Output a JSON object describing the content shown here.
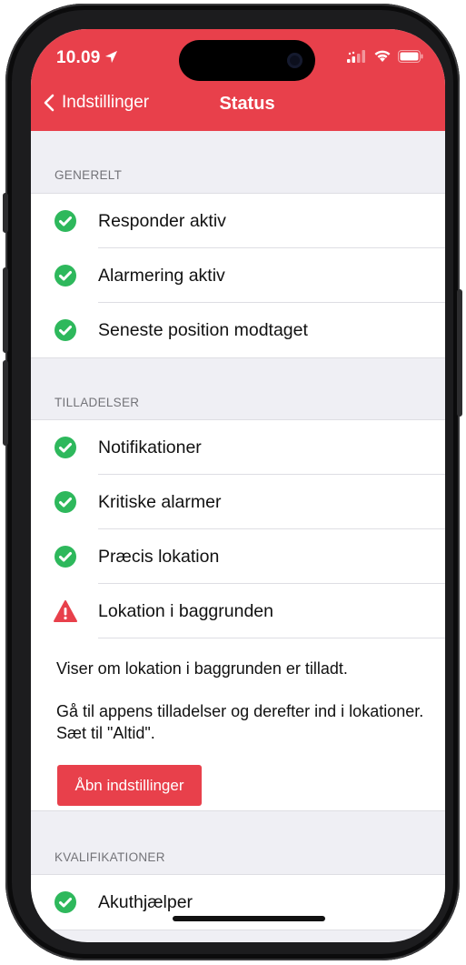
{
  "status_bar": {
    "time": "10.09"
  },
  "nav": {
    "back_label": "Indstillinger",
    "title": "Status"
  },
  "sections": {
    "general": {
      "header": "GENERELT",
      "items": [
        {
          "label": "Responder aktiv",
          "status": "ok"
        },
        {
          "label": "Alarmering aktiv",
          "status": "ok"
        },
        {
          "label": "Seneste position modtaget",
          "status": "ok"
        }
      ]
    },
    "permissions": {
      "header": "TILLADELSER",
      "items": [
        {
          "label": "Notifikationer",
          "status": "ok"
        },
        {
          "label": "Kritiske alarmer",
          "status": "ok"
        },
        {
          "label": "Præcis lokation",
          "status": "ok"
        },
        {
          "label": "Lokation i baggrunden",
          "status": "warning"
        }
      ],
      "description": "Viser om lokation i baggrunden er tilladt.",
      "instruction": "Gå til appens tilladelser og derefter ind i lokationer. Sæt til \"Altid\".",
      "button_label": "Åbn indstillinger"
    },
    "qualifications": {
      "header": "KVALIFIKATIONER",
      "items": [
        {
          "label": "Akuthjælper",
          "status": "ok"
        }
      ]
    }
  },
  "colors": {
    "accent": "#e8404b",
    "ok": "#2eb85c",
    "warning": "#e8404b",
    "background": "#efeff4"
  },
  "icons": {
    "ok": "checkmark-circle-icon",
    "warning": "warning-triangle-icon"
  }
}
